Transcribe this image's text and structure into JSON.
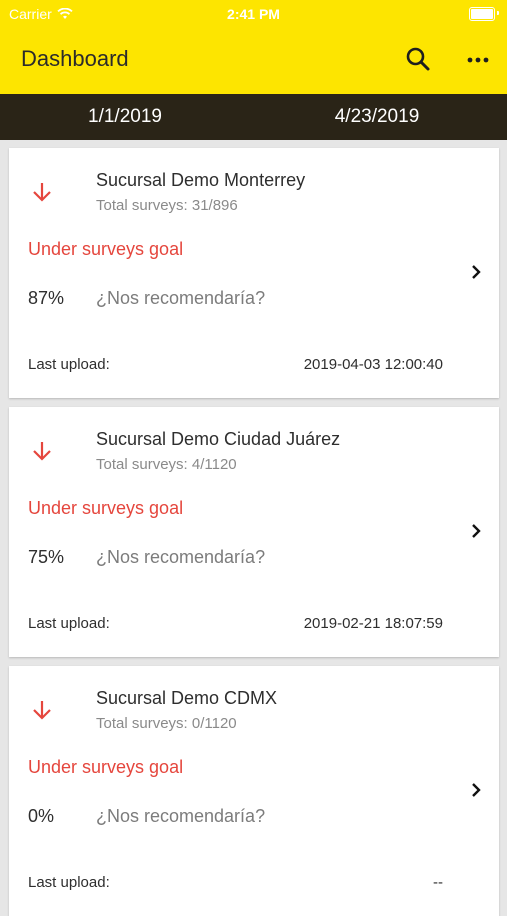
{
  "status_bar": {
    "carrier": "Carrier",
    "time": "2:41 PM"
  },
  "header": {
    "title": "Dashboard",
    "search_icon": "search-icon",
    "more_icon": "more-horizontal-icon",
    "background_color": "#fde500"
  },
  "date_range": {
    "start": "1/1/2019",
    "end": "4/23/2019",
    "background_color": "#2a2417"
  },
  "cards": [
    {
      "trend_icon": "arrow-down-icon",
      "branch_name": "Sucursal Demo Monterrey",
      "total_surveys": "Total surveys: 31/896",
      "goal_status": "Under surveys goal",
      "percent": "87%",
      "question": "¿Nos recomendaría?",
      "last_upload_label": "Last upload:",
      "last_upload_value": "2019-04-03 12:00:40"
    },
    {
      "trend_icon": "arrow-down-icon",
      "branch_name": "Sucursal Demo Ciudad Juárez",
      "total_surveys": "Total surveys: 4/1120",
      "goal_status": "Under surveys goal",
      "percent": "75%",
      "question": "¿Nos recomendaría?",
      "last_upload_label": "Last upload:",
      "last_upload_value": "2019-02-21 18:07:59"
    },
    {
      "trend_icon": "arrow-down-icon",
      "branch_name": "Sucursal Demo CDMX",
      "total_surveys": "Total surveys: 0/1120",
      "goal_status": "Under surveys goal",
      "percent": "0%",
      "question": "¿Nos recomendaría?",
      "last_upload_label": "Last upload:",
      "last_upload_value": "--"
    }
  ],
  "colors": {
    "alert_red": "#e5463d",
    "page_background": "#e6e6e6"
  }
}
